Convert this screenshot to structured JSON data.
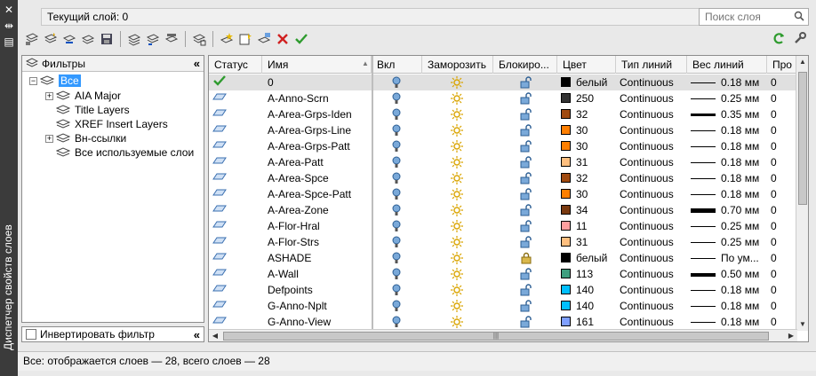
{
  "side": {
    "title": "Диспетчер свойств слоев",
    "close_glyph": "✕",
    "pin_glyph": "⇹",
    "menu_glyph": "▤"
  },
  "header": {
    "current_layer": "Текущий слой: 0",
    "search_placeholder": "Поиск слоя",
    "search_icon": "search-icon"
  },
  "toolbar": {
    "left_icons": [
      "new-property-filter-icon",
      "new-group-filter-icon",
      "layer-states-icon",
      "layer-states-manager-icon",
      "save-icon",
      "new-layer-icon",
      "new-vp-freeze-layer-icon",
      "delete-layer-icon",
      "set-current-icon",
      "layer-settings-icon"
    ],
    "right_icons": [
      "refresh-icon",
      "settings-icon"
    ]
  },
  "filters": {
    "header_label": "Фильтры",
    "items": [
      {
        "label": "Все",
        "level": 0,
        "expander": "−",
        "selected": true
      },
      {
        "label": "AIA Major",
        "level": 1,
        "expander": "+"
      },
      {
        "label": "Title Layers",
        "level": 1,
        "expander": ""
      },
      {
        "label": "XREF Insert Layers",
        "level": 1,
        "expander": ""
      },
      {
        "label": "Вн-ссылки",
        "level": 1,
        "expander": "+"
      },
      {
        "label": "Все используемые слои",
        "level": 1,
        "expander": ""
      }
    ],
    "invert_label": "Инвертировать фильтр"
  },
  "grid": {
    "columns": [
      "Статус",
      "Имя",
      "Вкл",
      "Заморозить",
      "Блокиро...",
      "Цвет",
      "Тип линий",
      "Вес линий",
      "Про"
    ],
    "rows": [
      {
        "status": "current",
        "name": "0",
        "color": "белый",
        "swatch": "#000000",
        "linetype": "Continuous",
        "weight": "0.18 мм",
        "thick": 1,
        "locked": false,
        "extra": "0"
      },
      {
        "status": "layer",
        "name": "A-Anno-Scrn",
        "color": "250",
        "swatch": "#333333",
        "linetype": "Continuous",
        "weight": "0.25 мм",
        "thick": 1,
        "locked": false,
        "extra": "0"
      },
      {
        "status": "layer",
        "name": "A-Area-Grps-Iden",
        "color": "32",
        "swatch": "#a04a10",
        "linetype": "Continuous",
        "weight": "0.35 мм",
        "thick": 3,
        "locked": false,
        "extra": "0"
      },
      {
        "status": "layer",
        "name": "A-Area-Grps-Line",
        "color": "30",
        "swatch": "#ff7f00",
        "linetype": "Continuous",
        "weight": "0.18 мм",
        "thick": 1,
        "locked": false,
        "extra": "0"
      },
      {
        "status": "layer",
        "name": "A-Area-Grps-Patt",
        "color": "30",
        "swatch": "#ff7f00",
        "linetype": "Continuous",
        "weight": "0.18 мм",
        "thick": 1,
        "locked": false,
        "extra": "0"
      },
      {
        "status": "layer",
        "name": "A-Area-Patt",
        "color": "31",
        "swatch": "#ffbf7f",
        "linetype": "Continuous",
        "weight": "0.18 мм",
        "thick": 1,
        "locked": false,
        "extra": "0"
      },
      {
        "status": "layer",
        "name": "A-Area-Spce",
        "color": "32",
        "swatch": "#a04a10",
        "linetype": "Continuous",
        "weight": "0.18 мм",
        "thick": 1,
        "locked": false,
        "extra": "0"
      },
      {
        "status": "layer",
        "name": "A-Area-Spce-Patt",
        "color": "30",
        "swatch": "#ff7f00",
        "linetype": "Continuous",
        "weight": "0.18 мм",
        "thick": 1,
        "locked": false,
        "extra": "0"
      },
      {
        "status": "layer",
        "name": "A-Area-Zone",
        "color": "34",
        "swatch": "#7a3a10",
        "linetype": "Continuous",
        "weight": "0.70 мм",
        "thick": 5,
        "locked": false,
        "extra": "0"
      },
      {
        "status": "layer",
        "name": "A-Flor-Hral",
        "color": "11",
        "swatch": "#ff9f9f",
        "linetype": "Continuous",
        "weight": "0.25 мм",
        "thick": 1,
        "locked": false,
        "extra": "0"
      },
      {
        "status": "layer",
        "name": "A-Flor-Strs",
        "color": "31",
        "swatch": "#ffbf7f",
        "linetype": "Continuous",
        "weight": "0.25 мм",
        "thick": 1,
        "locked": false,
        "extra": "0"
      },
      {
        "status": "layer",
        "name": "ASHADE",
        "color": "белый",
        "swatch": "#000000",
        "linetype": "Continuous",
        "weight": "По ум...",
        "thick": 1,
        "locked": true,
        "extra": "0"
      },
      {
        "status": "layer",
        "name": "A-Wall",
        "color": "113",
        "swatch": "#3f9f7f",
        "linetype": "Continuous",
        "weight": "0.50 мм",
        "thick": 4,
        "locked": false,
        "extra": "0"
      },
      {
        "status": "layer",
        "name": "Defpoints",
        "color": "140",
        "swatch": "#00bfff",
        "linetype": "Continuous",
        "weight": "0.18 мм",
        "thick": 1,
        "locked": false,
        "extra": "0"
      },
      {
        "status": "layer",
        "name": "G-Anno-Nplt",
        "color": "140",
        "swatch": "#00bfff",
        "linetype": "Continuous",
        "weight": "0.18 мм",
        "thick": 1,
        "locked": false,
        "extra": "0"
      },
      {
        "status": "layer",
        "name": "G-Anno-View",
        "color": "161",
        "swatch": "#7f9fff",
        "linetype": "Continuous",
        "weight": "0.18 мм",
        "thick": 1,
        "locked": false,
        "extra": "0"
      }
    ],
    "hscroll_glyph": "|||"
  },
  "status": {
    "text": "Все: отображается слоев — 28, всего слоев — 28"
  },
  "colors": {
    "accent": "#3399ff",
    "check": "#2e9b2e",
    "delete": "#d02020",
    "bulb": "#7aa9d9",
    "sun": "#d9a400"
  }
}
